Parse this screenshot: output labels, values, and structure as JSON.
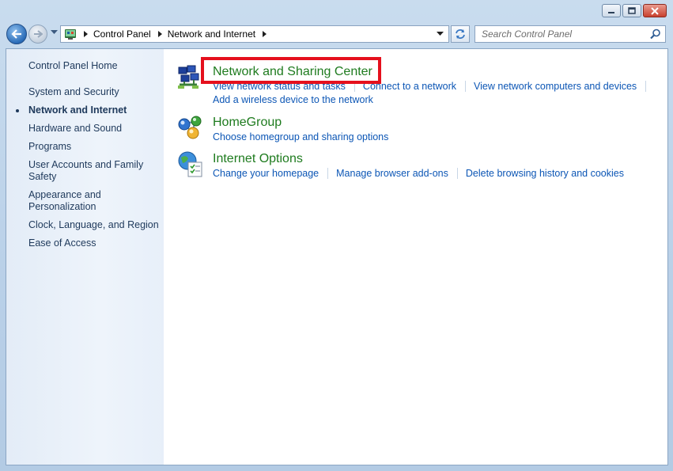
{
  "window": {
    "caption_buttons": [
      "minimize",
      "maximize",
      "close"
    ]
  },
  "navigation": {
    "breadcrumbs": [
      "Control Panel",
      "Network and Internet"
    ],
    "search_placeholder": "Search Control Panel"
  },
  "sidebar": {
    "home_label": "Control Panel Home",
    "items": [
      {
        "label": "System and Security",
        "current": false
      },
      {
        "label": "Network and Internet",
        "current": true
      },
      {
        "label": "Hardware and Sound",
        "current": false
      },
      {
        "label": "Programs",
        "current": false
      },
      {
        "label": "User Accounts and Family Safety",
        "current": false
      },
      {
        "label": "Appearance and Personalization",
        "current": false
      },
      {
        "label": "Clock, Language, and Region",
        "current": false
      },
      {
        "label": "Ease of Access",
        "current": false
      }
    ]
  },
  "categories": [
    {
      "title": "Network and Sharing Center",
      "icon": "network-sharing-center-icon",
      "links": [
        "View network status and tasks",
        "Connect to a network",
        "View network computers and devices"
      ],
      "links_line2": [
        "Add a wireless device to the network"
      ],
      "highlighted": true
    },
    {
      "title": "HomeGroup",
      "icon": "homegroup-icon",
      "links": [
        "Choose homegroup and sharing options"
      ]
    },
    {
      "title": "Internet Options",
      "icon": "internet-options-icon",
      "links": [
        "Change your homepage",
        "Manage browser add-ons",
        "Delete browsing history and cookies"
      ]
    }
  ],
  "colors": {
    "category_title": "#1e7b1e",
    "link": "#0c56b5",
    "sidebar_text": "#1e395b",
    "highlight_box": "#e5101d"
  }
}
